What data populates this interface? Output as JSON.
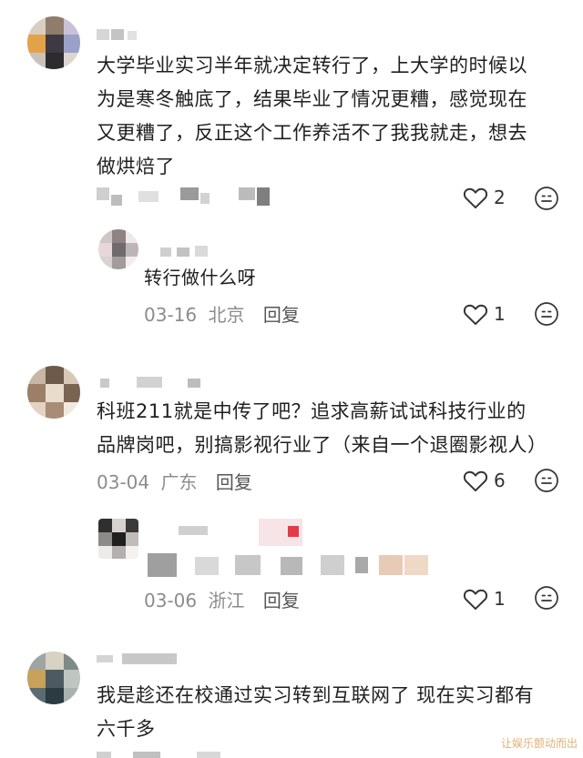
{
  "comments": [
    {
      "text_lines": [
        "大学毕业实习半年就决定转行了，上大学的时候以",
        "为是寒冬触底了，结果毕业了情况更糟，感觉现在",
        "又更糟了，反正这个工作养活不了我我就走，想去",
        "做烘焙了"
      ],
      "likes": "2",
      "reply": {
        "text": "转行做什么呀",
        "date": "03-16",
        "location": "北京",
        "reply_label": "回复",
        "likes": "1"
      }
    },
    {
      "text_lines": [
        "科班211就是中传了吧？追求高薪试试科技行业的",
        "品牌岗吧，别搞影视行业了（来自一个退圈影视人）"
      ],
      "date": "03-04",
      "location": "广东",
      "reply_label": "回复",
      "likes": "6",
      "reply": {
        "date": "03-06",
        "location": "浙江",
        "reply_label": "回复",
        "likes": "1"
      }
    },
    {
      "text_lines": [
        "我是趁还在校通过实习转到互联网了 现在实习都有",
        "六千多"
      ]
    }
  ],
  "icons": {
    "like": "heart-outline-icon",
    "emoji": "smiley-icon"
  },
  "watermark": "让娱乐颤动而出"
}
